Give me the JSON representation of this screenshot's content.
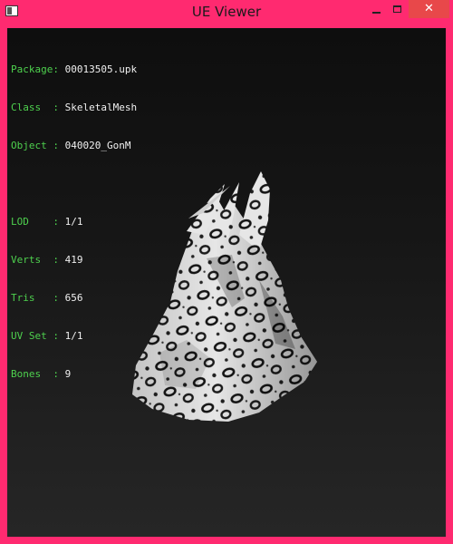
{
  "window": {
    "title": "UE Viewer",
    "controls": {
      "minimize": "minimize-icon",
      "maximize": "maximize-icon",
      "close": "✕"
    }
  },
  "info": {
    "package_key": "Package: ",
    "package": "00013505.upk",
    "class_key": "Class  : ",
    "class": "SkeletalMesh",
    "object_key": "Object : ",
    "object": "040020_GonM",
    "lod_key": "LOD    : ",
    "lod": "1/1",
    "verts_key": "Verts  : ",
    "verts": "419",
    "tris_key": "Tris   : ",
    "tris": "656",
    "uvset_key": "UV Set : ",
    "uvset": "1/1",
    "bones_key": "Bones  : ",
    "bones": "9"
  },
  "colors": {
    "frame": "#ff2a70",
    "close_button": "#e8484a",
    "label_green": "#4ed14e",
    "value_white": "#f0f0f0"
  }
}
